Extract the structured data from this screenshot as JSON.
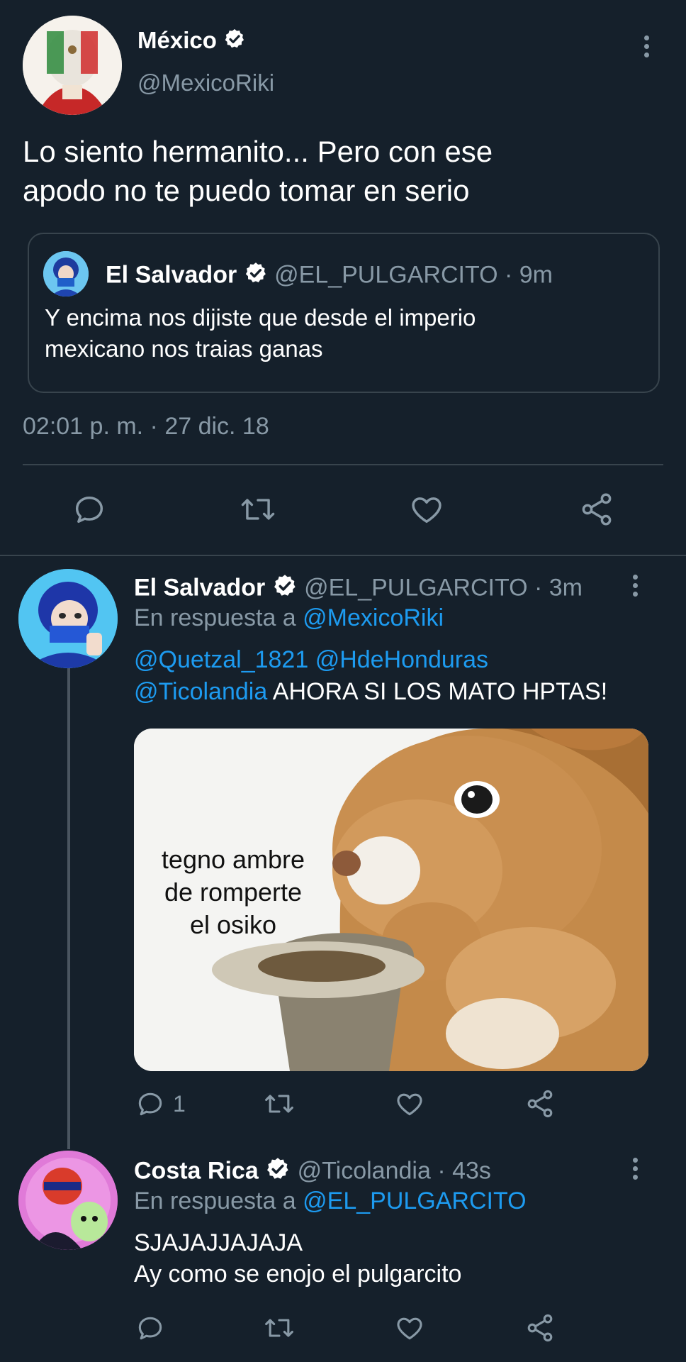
{
  "main_tweet": {
    "display_name": "México",
    "handle": "@MexicoRiki",
    "text_line1": "Lo siento hermanito... Pero con ese",
    "text_line2": "apodo no te puedo tomar en serio",
    "timestamp": "02:01 p. m. · 27 dic. 18",
    "quoted": {
      "display_name": "El Salvador",
      "handle_time": "@EL_PULGARCITO · 9m",
      "text_line1": "Y encima nos dijiste que desde el imperio",
      "text_line2": "mexicano nos traias ganas"
    }
  },
  "replies": [
    {
      "display_name": "El Salvador",
      "handle_time": "@EL_PULGARCITO · 3m",
      "reply_prefix": "En respuesta a ",
      "reply_to": "@MexicoRiki",
      "mention1": "@Quetzal_1821",
      "mention2": "@HdeHonduras",
      "mention3": "@Ticolandia",
      "text_rest": " AHORA SI LOS MATO HPTAS!",
      "reply_count": "1",
      "meme_text_line1": "tegno ambre",
      "meme_text_line2": "de romperte",
      "meme_text_line3": "el osiko"
    },
    {
      "display_name": "Costa Rica",
      "handle_time": "@Ticolandia · 43s",
      "reply_prefix": "En respuesta a ",
      "reply_to": "@EL_PULGARCITO",
      "text_line1": "SJAJAJJAJAJA",
      "text_line2": "Ay como se enojo el pulgarcito"
    }
  ],
  "colors": {
    "background": "#15202b",
    "muted": "#8899a6",
    "link": "#1d9bf0",
    "divider": "#38444d"
  }
}
